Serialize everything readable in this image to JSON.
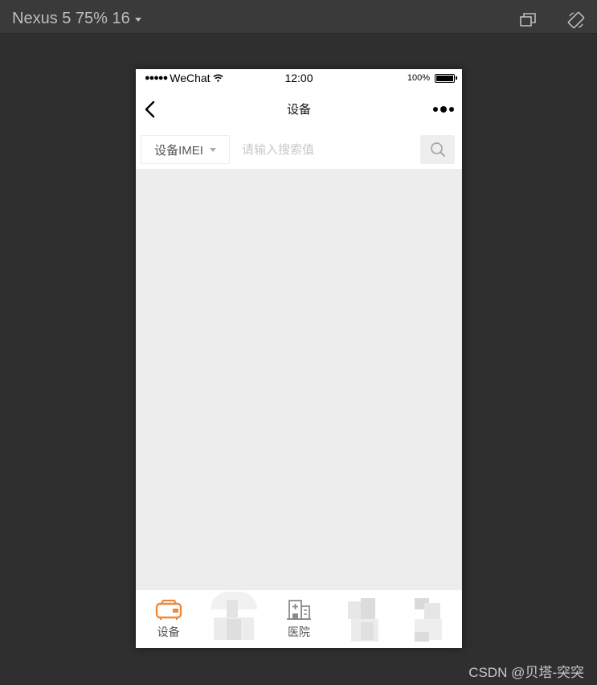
{
  "devtools": {
    "device_label": "Nexus 5 75% 16"
  },
  "status_bar": {
    "signal_dots": "●●●●●",
    "carrier": "WeChat",
    "time": "12:00",
    "battery": "100%"
  },
  "nav": {
    "title": "设备"
  },
  "search": {
    "filter_value": "设备IMEI",
    "placeholder": "请输入搜索值",
    "value": ""
  },
  "tabs": [
    {
      "label": "设备",
      "icon": "device-icon",
      "active": true,
      "color": "#f0883a"
    },
    {
      "label": "",
      "icon": "obscured-icon",
      "active": false
    },
    {
      "label": "医院",
      "icon": "hospital-icon",
      "active": false
    },
    {
      "label": "",
      "icon": "obscured-icon",
      "active": false
    },
    {
      "label": "",
      "icon": "obscured-icon",
      "active": false
    }
  ],
  "watermark": "CSDN @贝塔-突突",
  "colors": {
    "accent": "#f0883a",
    "content_bg": "#ededed",
    "devtools_bg": "#2f2f2f"
  }
}
